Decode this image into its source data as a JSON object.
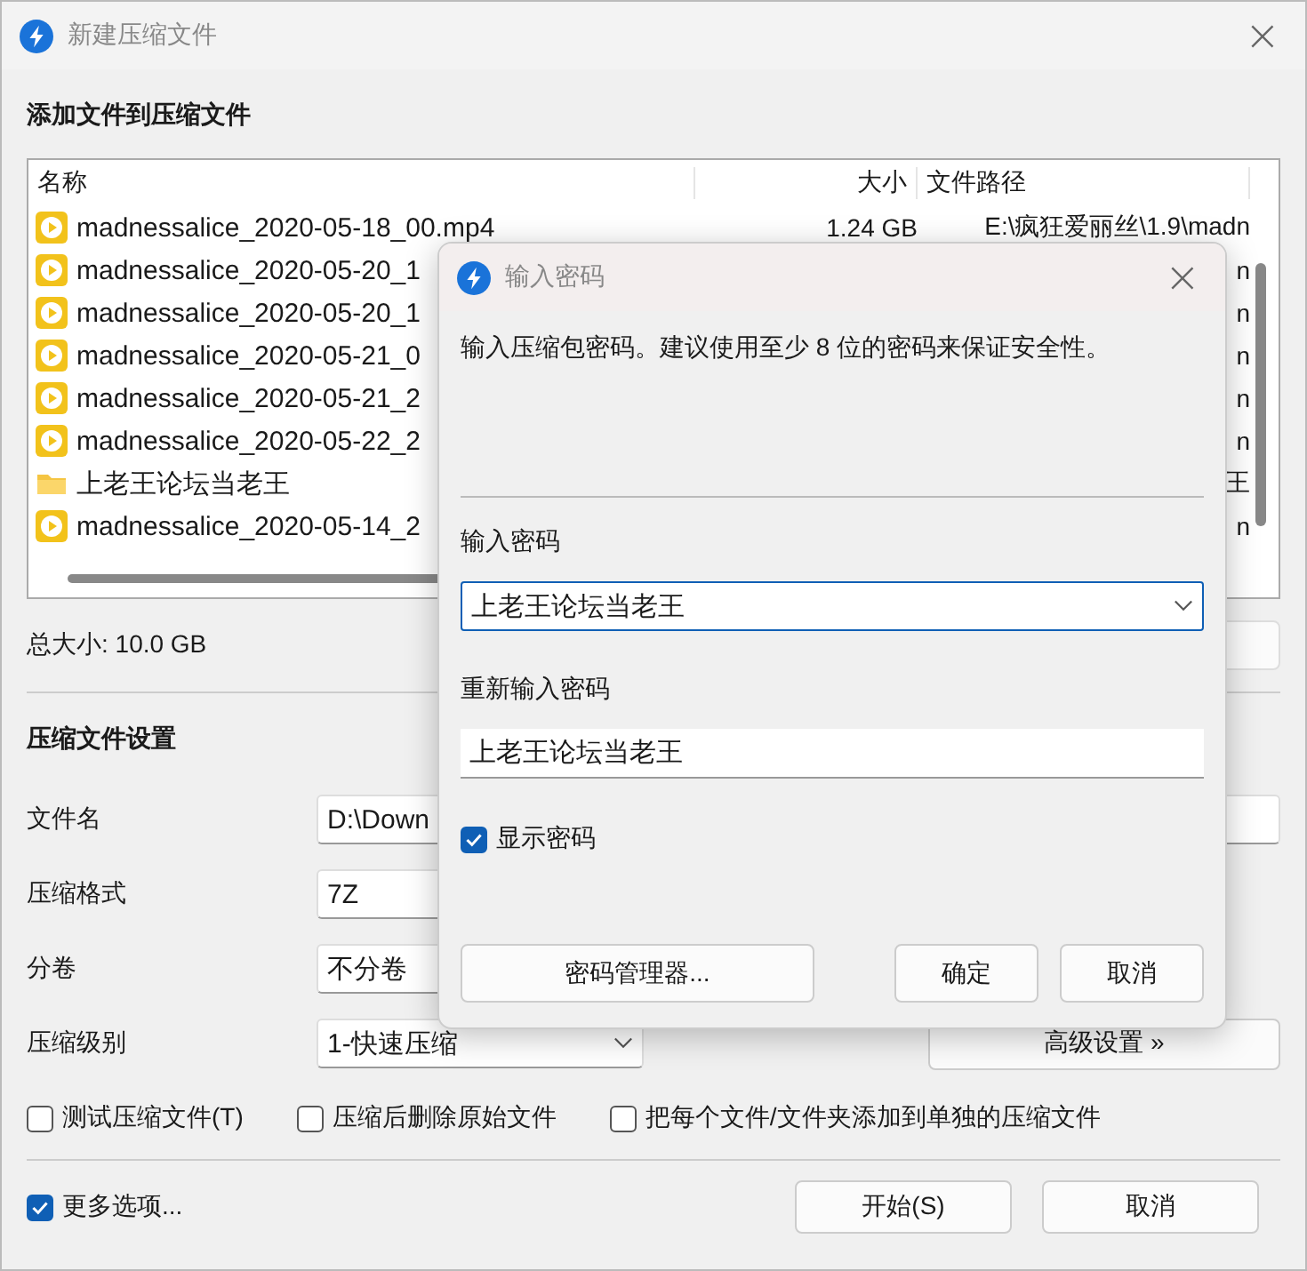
{
  "window": {
    "title": "新建压缩文件",
    "close": "×"
  },
  "files_section": {
    "heading": "添加文件到压缩文件",
    "columns": [
      "名称",
      "大小",
      "文件路径"
    ],
    "rows": [
      {
        "kind": "video",
        "name": "madnessalice_2020-05-18_00.mp4",
        "size": "1.24 GB",
        "path": "E:\\疯狂爱丽丝\\1.9\\madn"
      },
      {
        "kind": "video",
        "name": "madnessalice_2020-05-20_1",
        "path": "n"
      },
      {
        "kind": "video",
        "name": "madnessalice_2020-05-20_1",
        "path": "n"
      },
      {
        "kind": "video",
        "name": "madnessalice_2020-05-21_0",
        "path": "n"
      },
      {
        "kind": "video",
        "name": "madnessalice_2020-05-21_2",
        "path": "n"
      },
      {
        "kind": "video",
        "name": "madnessalice_2020-05-22_2",
        "path": "n"
      },
      {
        "kind": "folder",
        "name": "上老王论坛当老王",
        "path": "王"
      },
      {
        "kind": "video",
        "name": "madnessalice_2020-05-14_2",
        "path": "n"
      }
    ],
    "total_size": "总大小: 10.0 GB"
  },
  "settings": {
    "heading": "压缩文件设置",
    "fields": [
      {
        "kind": "text",
        "label": "文件名",
        "value": "D:\\Down"
      },
      {
        "kind": "select-cut",
        "label": "压缩格式",
        "value": "7Z"
      },
      {
        "kind": "select-cut",
        "label": "分卷",
        "value": "不分卷"
      },
      {
        "kind": "select",
        "label": "压缩级别",
        "value": "1-快速压缩"
      }
    ],
    "advanced_button": "高级设置 »",
    "options": [
      {
        "label": "测试压缩文件(T)",
        "checked": false
      },
      {
        "label": "压缩后删除原始文件",
        "checked": false
      },
      {
        "label": "把每个文件/文件夹添加到单独的压缩文件",
        "checked": false
      }
    ]
  },
  "footer": {
    "more_options": {
      "label": "更多选项...",
      "checked": true
    },
    "buttons": [
      "开始(S)",
      "取消"
    ]
  },
  "password_dialog": {
    "title": "输入密码",
    "close": "×",
    "description": "输入压缩包密码。建议使用至少 8 位的密码来保证安全性。",
    "password_label": "输入密码",
    "password_value": "上老王论坛当老王",
    "confirm_label": "重新输入密码",
    "confirm_value": "上老王论坛当老王",
    "show_password": {
      "label": "显示密码",
      "checked": true
    },
    "manager_button": "密码管理器...",
    "buttons": [
      "确定",
      "取消"
    ]
  }
}
